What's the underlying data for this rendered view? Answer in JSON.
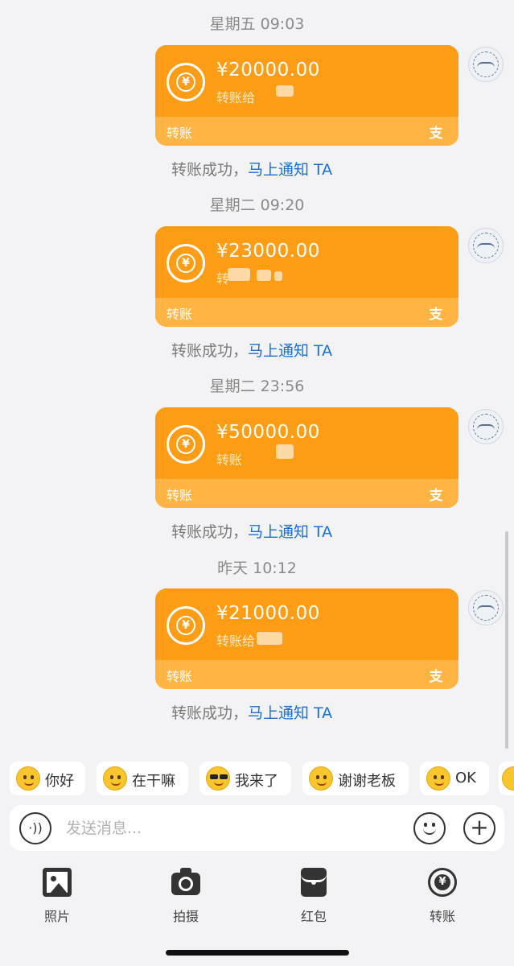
{
  "messages": [
    {
      "time": "星期五 09:03",
      "amount": "¥20000.00",
      "note": "转账给",
      "card_label": "转账",
      "status": "转账成功，",
      "status_link": "马上通知 TA"
    },
    {
      "time": "星期二 09:20",
      "amount": "¥23000.00",
      "note": "转",
      "card_label": "转账",
      "status": "转账成功，",
      "status_link": "马上通知 TA"
    },
    {
      "time": "星期二 23:56",
      "amount": "¥50000.00",
      "note": "转账",
      "card_label": "转账",
      "status": "转账成功，",
      "status_link": "马上通知 TA"
    },
    {
      "time": "昨天 10:12",
      "amount": "¥21000.00",
      "note": "转账给",
      "card_label": "转账",
      "status": "转账成功，",
      "status_link": "马上通知 TA"
    }
  ],
  "icons": {
    "coin": "transfer-coin-icon",
    "alipay": "alipay-icon",
    "avatar": "contact-avatar"
  },
  "coin_glyph": "¥",
  "alipay_glyph": "支",
  "quick_replies": [
    "你好",
    "在干嘛",
    "我来了",
    "谢谢老板",
    "OK"
  ],
  "input": {
    "placeholder": "发送消息...",
    "value": ""
  },
  "toolbar": {
    "photo": "照片",
    "camera": "拍摄",
    "red_packet": "红包",
    "transfer": "转账"
  },
  "colors": {
    "card": "#fc9d15",
    "card_footer": "#ffb443",
    "link": "#1a6fd8",
    "background": "#f3f3f5"
  }
}
